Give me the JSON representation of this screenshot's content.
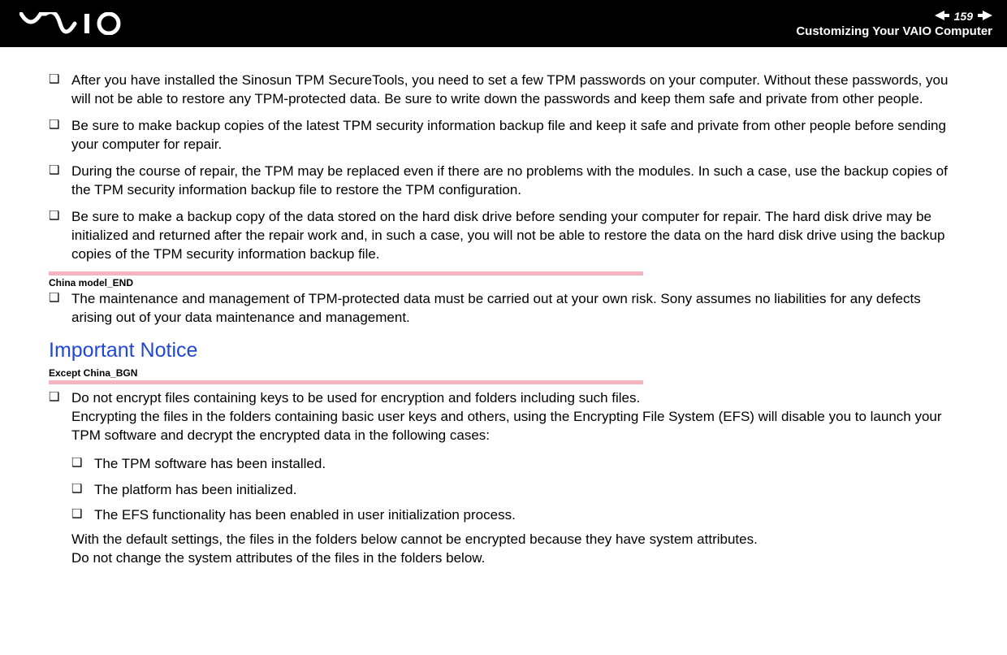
{
  "header": {
    "page_number": "159",
    "subtitle": "Customizing Your VAIO Computer"
  },
  "bullets_a": [
    "After you have installed the Sinosun TPM SecureTools, you need to set a few TPM passwords on your computer. Without these passwords, you will not be able to restore any TPM-protected data. Be sure to write down the passwords and keep them safe and private from other people.",
    "Be sure to make backup copies of the latest TPM security information backup file and keep it safe and private from other people before sending your computer for repair.",
    "During the course of repair, the TPM may be replaced even if there are no problems with the modules. In such a case, use the backup copies of the TPM security information backup file to restore the TPM configuration.",
    "Be sure to make a backup copy of the data stored on the hard disk drive before sending your computer for repair. The hard disk drive may be initialized and returned after the repair work and, in such a case, you will not be able to restore the data on the hard disk drive using the backup copies of the TPM security information backup file."
  ],
  "marker1": "China model_END",
  "bullets_b": [
    "The maintenance and management of TPM-protected data must be carried out at your own risk. Sony assumes no liabilities for any defects arising out of your data maintenance and management."
  ],
  "heading": "Important Notice",
  "marker2": "Except China_BGN",
  "notice_intro": "Do not encrypt files containing keys to be used for encryption and folders including such files.\nEncrypting the files in the folders containing basic user keys and others, using the Encrypting File System (EFS) will disable you to launch your TPM software and decrypt the encrypted data in the following cases:",
  "notice_sub": [
    "The TPM software has been installed.",
    "The platform has been initialized.",
    "The EFS functionality has been enabled in user initialization process."
  ],
  "notice_trail": "With the default settings, the files in the folders below cannot be encrypted because they have system attributes.\nDo not change the system attributes of the files in the folders below."
}
